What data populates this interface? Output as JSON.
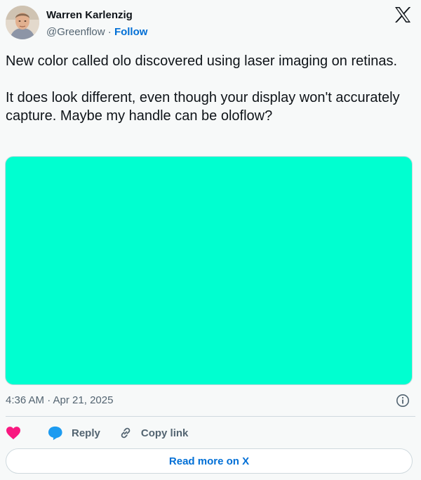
{
  "author": {
    "name": "Warren Karlenzig",
    "handle": "@Greenflow",
    "separator": " · ",
    "follow_label": "Follow"
  },
  "tweet": {
    "paragraphs": [
      "New color called olo discovered using laser imaging on retinas.",
      "It does look different, even though your display won't accurately capture. Maybe my handle can be oloflow?"
    ],
    "media_color": "#00ffd0",
    "timestamp": "4:36 AM · Apr 21, 2025"
  },
  "actions": {
    "like_icon": "heart-icon",
    "reply_label": "Reply",
    "reply_icon": "speech-bubble-icon",
    "copy_label": "Copy link",
    "copy_icon": "link-icon"
  },
  "read_more_label": "Read more on X",
  "colors": {
    "link": "#006fd6",
    "like": "#f91880",
    "reply": "#1d9bf0",
    "muted": "#536471",
    "background": "#f7f9f9"
  }
}
